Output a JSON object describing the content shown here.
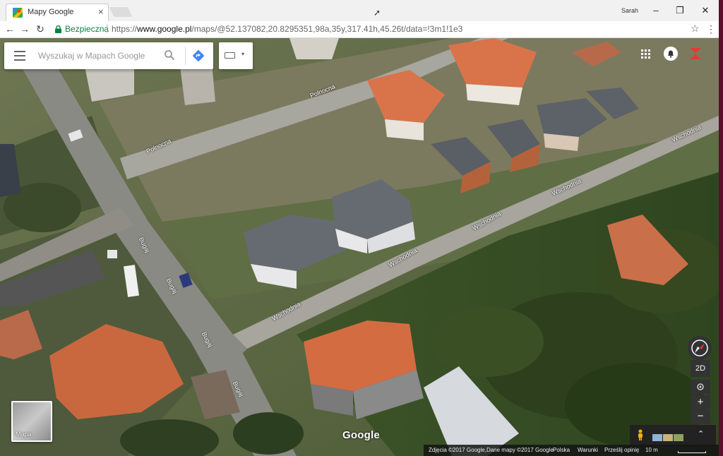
{
  "browser": {
    "tab_title": "Mapy Google",
    "tab_close": "×",
    "profile_name": "Sarah",
    "window_controls": {
      "minimize": "–",
      "maximize": "❐",
      "close": "✕"
    },
    "nav": {
      "back": "←",
      "forward": "→",
      "reload": "↻"
    },
    "security_label": "Bezpieczna",
    "url_scheme": "https://",
    "url_host": "www.google.pl",
    "url_path": "/maps/@52.137082,20.8295351,98a,35y,317.41h,45.26t/data=!3m1!1e3",
    "bookmark_star": "☆",
    "menu": "⋮"
  },
  "maps": {
    "search_placeholder": "Wyszukaj w Mapach Google",
    "keyboard_caret": "▾",
    "street_labels": [
      {
        "text": "Wschodnia"
      },
      {
        "text": "Wschodnia"
      },
      {
        "text": "Wschodnia"
      },
      {
        "text": "Wschodnia"
      },
      {
        "text": "Wschodnia"
      },
      {
        "text": "Bugaj"
      },
      {
        "text": "Bugaj"
      },
      {
        "text": "Bugaj"
      },
      {
        "text": "Bugaj"
      },
      {
        "text": "Polnocna"
      },
      {
        "text": "Polnocna"
      }
    ],
    "view_2d_label": "2D",
    "zoom_in": "+",
    "zoom_out": "−",
    "layer_label": "Mapa",
    "logo_text": "Google",
    "expand": "⌃",
    "footer": {
      "attribution": "Zdjęcia ©2017 Google,Dane mapy ©2017 Google",
      "country": "Polska",
      "terms": "Warunki",
      "feedback": "Prześlij opinię",
      "scale": "10 m"
    }
  },
  "colors": {
    "secure_green": "#0b8043",
    "directions_blue": "#4285f4",
    "account_red": "#e53935",
    "roof_orange": "#d9744a"
  }
}
